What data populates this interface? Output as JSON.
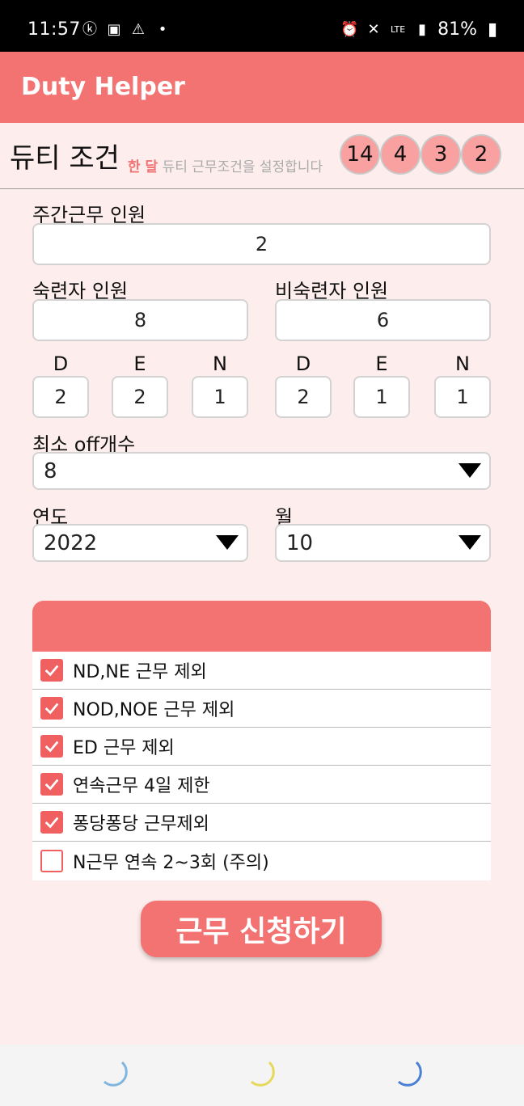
{
  "status_bar": {
    "time": "11:57",
    "battery": "81%",
    "left_icons": [
      "notification-k-icon",
      "image-icon",
      "warning-icon",
      "dot-icon"
    ],
    "right_icons": [
      "alarm-icon",
      "mute-icon",
      "lte-icon",
      "signal-icon",
      "battery-icon"
    ]
  },
  "app_bar": {
    "title": "Duty Helper",
    "color": "#f37272"
  },
  "header": {
    "title": "듀티 조건",
    "subtitle_highlight": "한 달",
    "subtitle_rest": " 듀티 근무조건을 설정합니다",
    "counts": [
      "14",
      "4",
      "3",
      "2"
    ]
  },
  "form": {
    "day_staff_label": "주간근무 인원",
    "day_staff_value": "2",
    "skilled_label": "숙련자 인원",
    "skilled_value": "8",
    "unskilled_label": "비숙련자 인원",
    "unskilled_value": "6",
    "shift_labels": [
      "D",
      "E",
      "N",
      "D",
      "E",
      "N"
    ],
    "skilled_shifts": [
      "2",
      "2",
      "1"
    ],
    "unskilled_shifts": [
      "2",
      "1",
      "1"
    ],
    "min_off_label": "최소 off개수",
    "min_off_value": "8",
    "year_label": "연도",
    "year_value": "2022",
    "month_label": "월",
    "month_value": "10"
  },
  "options": [
    {
      "label": "ND,NE 근무 제외",
      "checked": true
    },
    {
      "label": "NOD,NOE 근무 제외",
      "checked": true
    },
    {
      "label": "ED 근무 제외",
      "checked": true
    },
    {
      "label": "연속근무 4일 제한",
      "checked": true
    },
    {
      "label": "퐁당퐁당 근무제외",
      "checked": true
    },
    {
      "label": "N근무 연속 2~3회 (주의)",
      "checked": false
    }
  ],
  "submit_label": "근무 신청하기",
  "bottom_nav": [
    {
      "icon": "moon-icon",
      "color": "#7fb6e0"
    },
    {
      "icon": "moon-icon",
      "color": "#e6d85a"
    },
    {
      "icon": "moon-icon",
      "color": "#4a7fd4"
    }
  ]
}
